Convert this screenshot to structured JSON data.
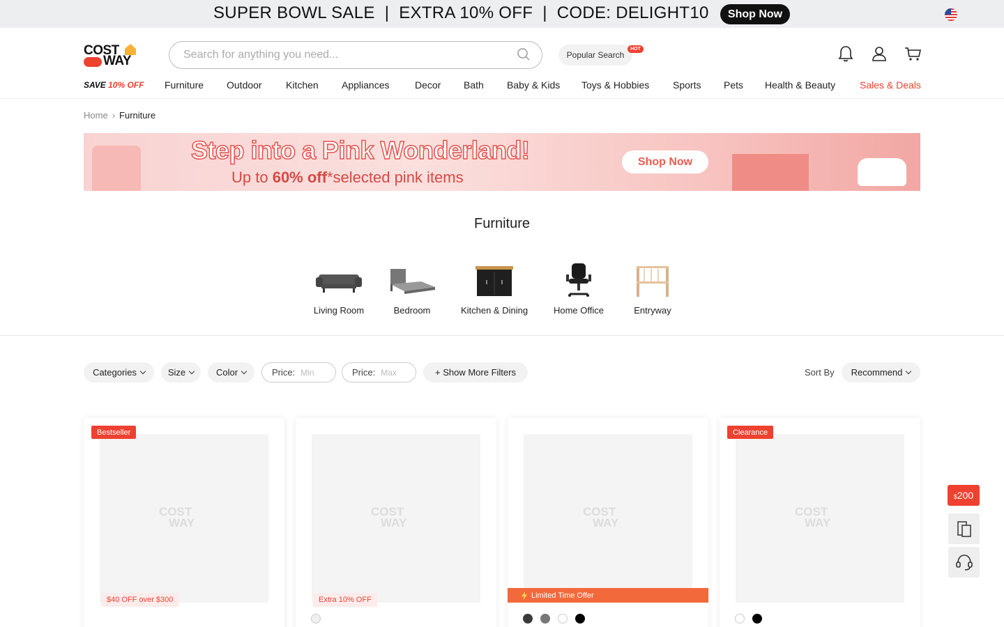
{
  "promo_bar": {
    "part1": "SUPER BOWL SALE",
    "separator": "|",
    "part2": "EXTRA 10% OFF",
    "part3": "CODE: DELIGHT10",
    "button": "Shop Now",
    "flag_icon": "us-flag-icon"
  },
  "header": {
    "logo_line1": "COST",
    "logo_line2": "WAY",
    "search_placeholder": "Search for anything you need...",
    "popular_search": "Popular Search",
    "hot_badge": "HOT"
  },
  "nav": {
    "save_prefix": "SAVE ",
    "save_highlight": "10% OFF",
    "items": [
      "Furniture",
      "Outdoor",
      "Kitchen",
      "Appliances",
      "Decor",
      "Bath",
      "Baby & Kids",
      "Toys & Hobbies",
      "Sports",
      "Pets",
      "Health & Beauty",
      "Sales & Deals"
    ]
  },
  "breadcrumb": {
    "home": "Home",
    "separator": "›",
    "current": "Furniture"
  },
  "banner": {
    "headline": "Step into a Pink Wonderland!",
    "sub_prefix": "Up to ",
    "sub_bold": "60% off",
    "sub_suffix": "*selected pink items",
    "button": "Shop Now"
  },
  "category": {
    "title": "Furniture",
    "items": [
      "Living Room",
      "Bedroom",
      "Kitchen & Dining",
      "Home Office",
      "Entryway"
    ]
  },
  "filters": {
    "categories": "Categories",
    "size": "Size",
    "color": "Color",
    "price_label": "Price:",
    "price_min": "Min",
    "price_max": "Max",
    "more": "+ Show More Filters",
    "sort_label": "Sort By",
    "sort_value": "Recommend"
  },
  "products": [
    {
      "badge": "Bestseller",
      "tag": "$40 OFF over $300"
    },
    {
      "tag": "Extra 10% OFF"
    },
    {
      "limited": "Limited Time Offer"
    },
    {
      "badge": "Clearance"
    }
  ],
  "placeholder_logo": {
    "line1": "COST",
    "line2": "WAY"
  },
  "float": {
    "coupon_currency": "$",
    "coupon_value": "200"
  },
  "colors": {
    "brand_red": "#ef4130",
    "limited_orange": "#f26a3b"
  }
}
